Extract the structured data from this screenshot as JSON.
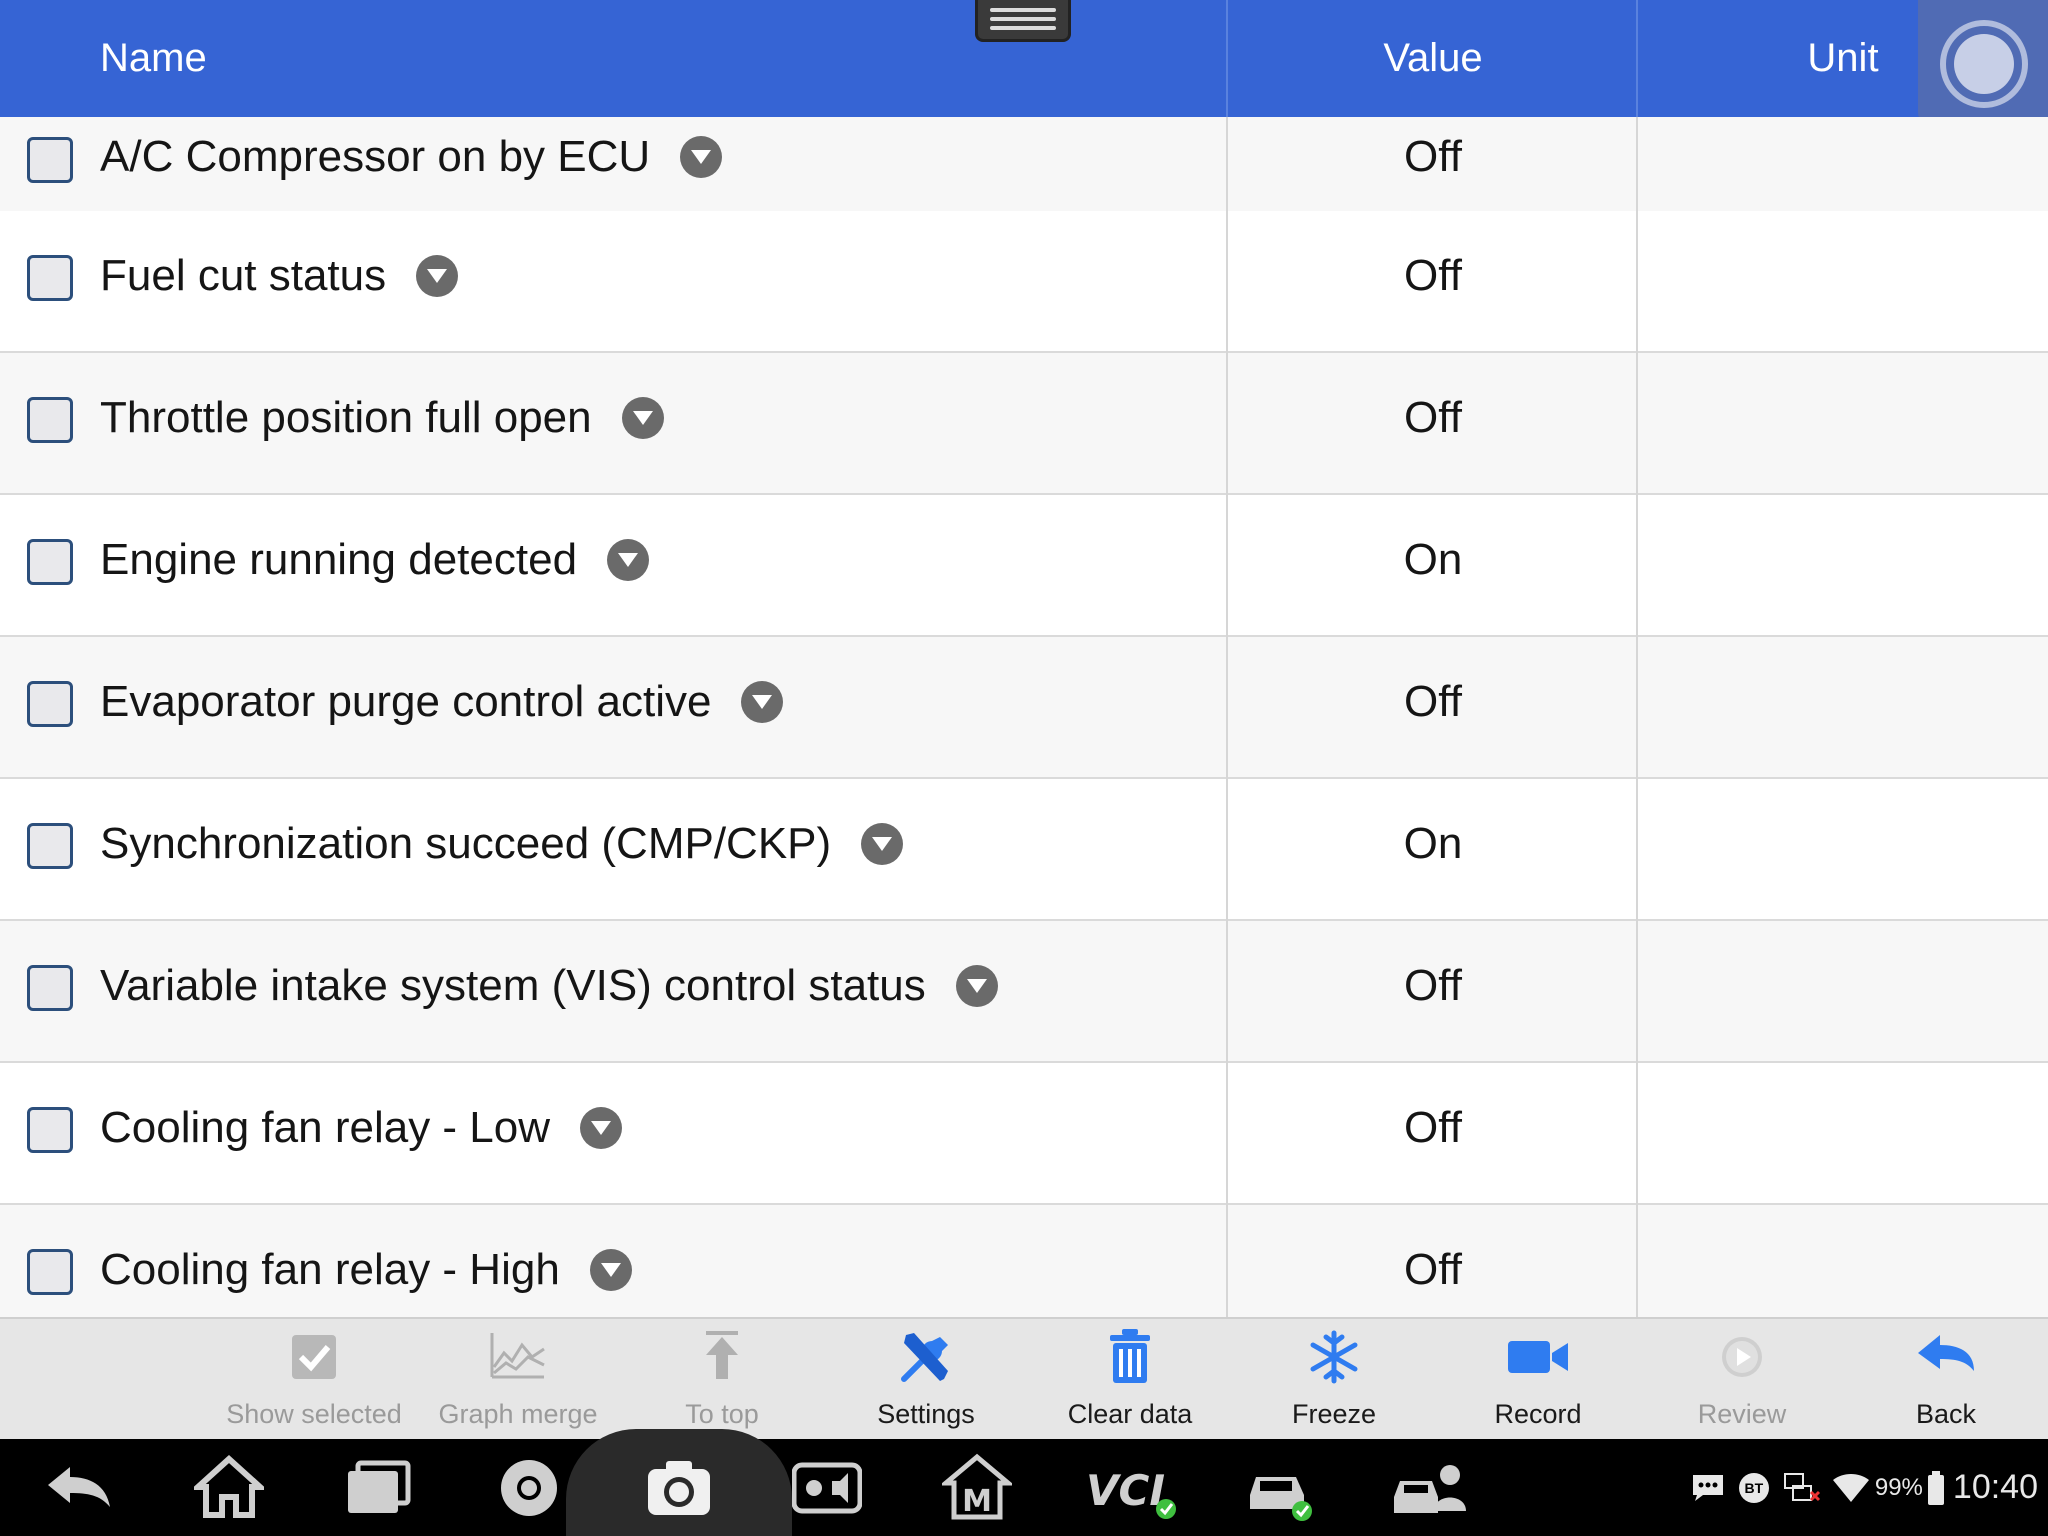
{
  "header": {
    "name": "Name",
    "value": "Value",
    "unit": "Unit"
  },
  "rows": [
    {
      "name": "A/C Compressor on by ECU",
      "value": "Off",
      "unit": ""
    },
    {
      "name": "Fuel cut status",
      "value": "Off",
      "unit": ""
    },
    {
      "name": "Throttle position full open",
      "value": "Off",
      "unit": ""
    },
    {
      "name": "Engine running detected",
      "value": "On",
      "unit": ""
    },
    {
      "name": "Evaporator purge control active",
      "value": "Off",
      "unit": ""
    },
    {
      "name": "Synchronization succeed (CMP/CKP)",
      "value": "On",
      "unit": ""
    },
    {
      "name": "Variable intake system (VIS) control status",
      "value": "Off",
      "unit": ""
    },
    {
      "name": "Cooling fan relay - Low",
      "value": "Off",
      "unit": ""
    },
    {
      "name": "Cooling fan relay - High",
      "value": "Off",
      "unit": ""
    }
  ],
  "toolbar": {
    "show_selected": "Show selected",
    "graph_merge": "Graph merge",
    "to_top": "To top",
    "settings": "Settings",
    "clear_data": "Clear data",
    "freeze": "Freeze",
    "record": "Record",
    "review": "Review",
    "back": "Back"
  },
  "status": {
    "battery": "99%",
    "time": "10:40",
    "bt": "BT"
  },
  "colors": {
    "header_bg": "#3664d4",
    "accent": "#2f7cf0",
    "sysbar": "#000000"
  },
  "icons": [
    "back-nav-icon",
    "home-icon",
    "recents-icon",
    "chrome-icon",
    "camera-icon",
    "brightness-volume-icon",
    "maxifix-icon",
    "vci-icon",
    "car-check-icon",
    "car-user-icon"
  ]
}
